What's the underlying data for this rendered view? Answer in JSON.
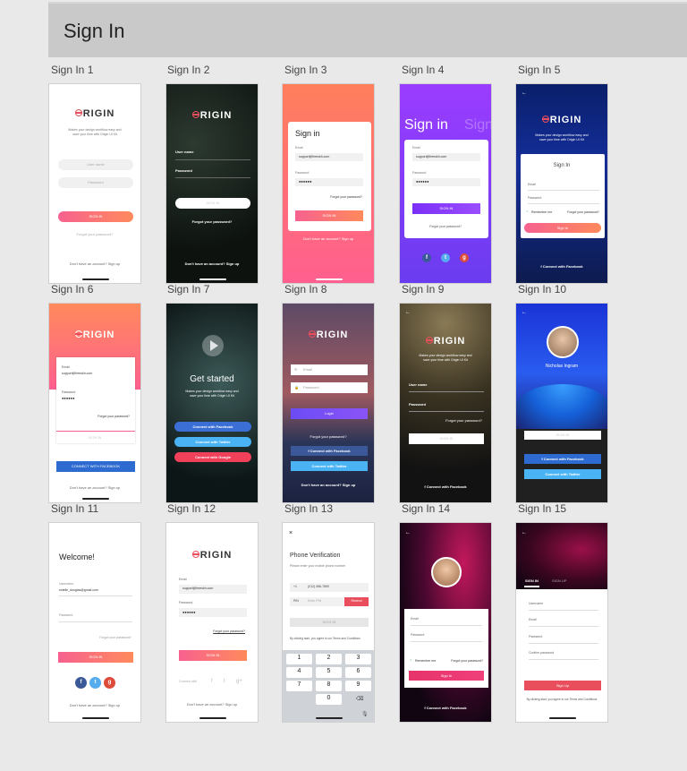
{
  "page_title": "Sign In",
  "cards": [
    {
      "label": "Sign In 1"
    },
    {
      "label": "Sign In 2"
    },
    {
      "label": "Sign In 3"
    },
    {
      "label": "Sign In 4"
    },
    {
      "label": "Sign In 5"
    },
    {
      "label": "Sign In 6"
    },
    {
      "label": "Sign In 7"
    },
    {
      "label": "Sign In 8"
    },
    {
      "label": "Sign In 9"
    },
    {
      "label": "Sign In 10"
    },
    {
      "label": "Sign In 11"
    },
    {
      "label": "Sign In 12"
    },
    {
      "label": "Sign In 13"
    },
    {
      "label": "Sign In 14"
    },
    {
      "label": "Sign In 15"
    }
  ],
  "brand": {
    "logo": "RIGIN",
    "tagline_1": "Makes your design workflow easy and",
    "tagline_2": "save your time with Origin UI Kit"
  },
  "common": {
    "username": "User name",
    "username2": "Username",
    "user_name_cap": "User name",
    "password": "Password",
    "email": "Email",
    "email_value": "support@freeskh.com",
    "password_dots": "●●●●●●",
    "sign_in": "SIGN IN",
    "sign_in_title": "Sign in",
    "sign_in_title2": "Sign In",
    "login": "Login",
    "forgot": "Forgot your password?",
    "signup_prompt": "Don't have an account? Sign up",
    "connect_facebook": "Connect with Facebook",
    "connect_twitter": "Connect with Twitter",
    "connect_google": "Connect with Google",
    "connect_facebook_caps": "CONNECT WITH FACEBOOK",
    "remember": "Remember me",
    "connect_with": "Connect with",
    "get_started": "Get started",
    "welcome": "Welcome!",
    "profile_name": "Nicholas Ingram",
    "welcome_email": "estelle_douglas@gmail.com",
    "sign_up": "Sign Up",
    "confirm_password": "Confirm password",
    "tab_sign_in": "SIGN IN",
    "tab_sign_up": "SIGN UP",
    "terms": "By clicking start, you agree to our Terms and Conditions"
  },
  "phone": {
    "title": "Phone Verification",
    "subtitle": "Please enter your mobile phone number",
    "country_code": "+1",
    "phone_value": "(212) 456-7890",
    "pin_label": "PIN",
    "pin_placeholder": "Enter PIN",
    "resend": "Resend",
    "sign_in": "SIGN IN",
    "terms": "By clicking start, you agree to our Terms and Conditions",
    "keys": [
      "1",
      "2",
      "3",
      "4",
      "5",
      "6",
      "7",
      "8",
      "9",
      "0"
    ]
  },
  "colors": {
    "accent_pink": "#f7618f",
    "accent_orange": "#ff8a5c",
    "facebook": "#3b5998",
    "twitter": "#55acee",
    "google": "#dd4b39",
    "purple": "#7b2ff7"
  }
}
